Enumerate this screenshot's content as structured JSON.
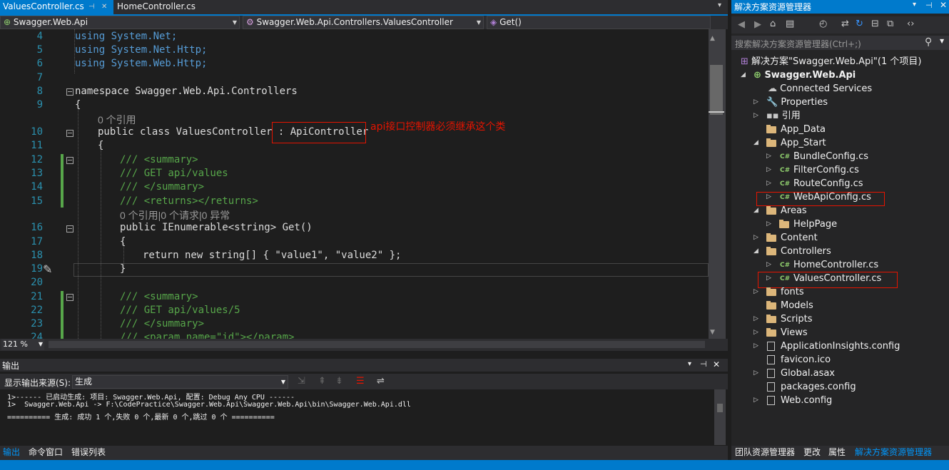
{
  "tabs": {
    "active": "ValuesController.cs",
    "inactive": "HomeController.cs"
  },
  "navbar": {
    "project": "Swagger.Web.Api",
    "class": "Swagger.Web.Api.Controllers.ValuesController",
    "member": "Get()"
  },
  "code": {
    "lines": [
      {
        "n": "4",
        "t": "using System.Net;"
      },
      {
        "n": "5",
        "t": "using System.Net.Http;"
      },
      {
        "n": "6",
        "t": "using System.Web.Http;"
      },
      {
        "n": "7",
        "t": ""
      },
      {
        "n": "8",
        "t": "namespace Swagger.Web.Api.Controllers"
      },
      {
        "n": "9",
        "t": "{"
      },
      {
        "n": "10",
        "t": "public class ValuesController : ApiController"
      },
      {
        "n": "11",
        "t": "{"
      },
      {
        "n": "12",
        "t": "/// <summary>"
      },
      {
        "n": "13",
        "t": "/// GET api/values"
      },
      {
        "n": "14",
        "t": "/// </summary>"
      },
      {
        "n": "15",
        "t": "/// <returns></returns>"
      },
      {
        "n": "16",
        "t": "public IEnumerable<string> Get()"
      },
      {
        "n": "17",
        "t": "{"
      },
      {
        "n": "18",
        "t": "return new string[] { \"value1\", \"value2\" };"
      },
      {
        "n": "19",
        "t": "}"
      },
      {
        "n": "20",
        "t": ""
      },
      {
        "n": "21",
        "t": "/// <summary>"
      },
      {
        "n": "22",
        "t": "/// GET api/values/5"
      },
      {
        "n": "23",
        "t": "/// </summary>"
      },
      {
        "n": "24",
        "t": "/// <param name=\"id\"></param>"
      }
    ],
    "lens_class": "0 个引用",
    "lens_method": "0 个引用|0 个请求|0 异常",
    "annotation": "api接口控制器必须继承这个类"
  },
  "zoom": "121 %",
  "output": {
    "title": "输出",
    "source_label": "显示输出来源(S):",
    "source_value": "生成",
    "lines": [
      "1>------ 已启动生成: 项目: Swagger.Web.Api, 配置: Debug Any CPU ------",
      "1>  Swagger.Web.Api -> F:\\CodePractice\\Swagger.Web.Api\\Swagger.Web.Api\\bin\\Swagger.Web.Api.dll",
      "========== 生成: 成功 1 个,失败 0 个,最新 0 个,跳过 0 个 =========="
    ]
  },
  "bottom_tabs": [
    "输出",
    "命令窗口",
    "错误列表"
  ],
  "solution": {
    "title": "解决方案资源管理器",
    "search_placeholder": "搜索解决方案资源管理器(Ctrl+;)",
    "items": [
      {
        "label": "解决方案\"Swagger.Web.Api\"(1 个项目)"
      },
      {
        "label": "Swagger.Web.Api"
      },
      {
        "label": "Connected Services"
      },
      {
        "label": "Properties"
      },
      {
        "label": "引用"
      },
      {
        "label": "App_Data"
      },
      {
        "label": "App_Start"
      },
      {
        "label": "BundleConfig.cs"
      },
      {
        "label": "FilterConfig.cs"
      },
      {
        "label": "RouteConfig.cs"
      },
      {
        "label": "WebApiConfig.cs"
      },
      {
        "label": "Areas"
      },
      {
        "label": "HelpPage"
      },
      {
        "label": "Content"
      },
      {
        "label": "Controllers"
      },
      {
        "label": "HomeController.cs"
      },
      {
        "label": "ValuesController.cs"
      },
      {
        "label": "fonts"
      },
      {
        "label": "Models"
      },
      {
        "label": "Scripts"
      },
      {
        "label": "Views"
      },
      {
        "label": "ApplicationInsights.config"
      },
      {
        "label": "favicon.ico"
      },
      {
        "label": "Global.asax"
      },
      {
        "label": "packages.config"
      },
      {
        "label": "Web.config"
      }
    ],
    "bottom_tabs": [
      "团队资源管理器",
      "更改",
      "属性",
      "解决方案资源管理器"
    ]
  },
  "colors": {
    "accent": "#007acc",
    "annotation": "#e51400"
  }
}
